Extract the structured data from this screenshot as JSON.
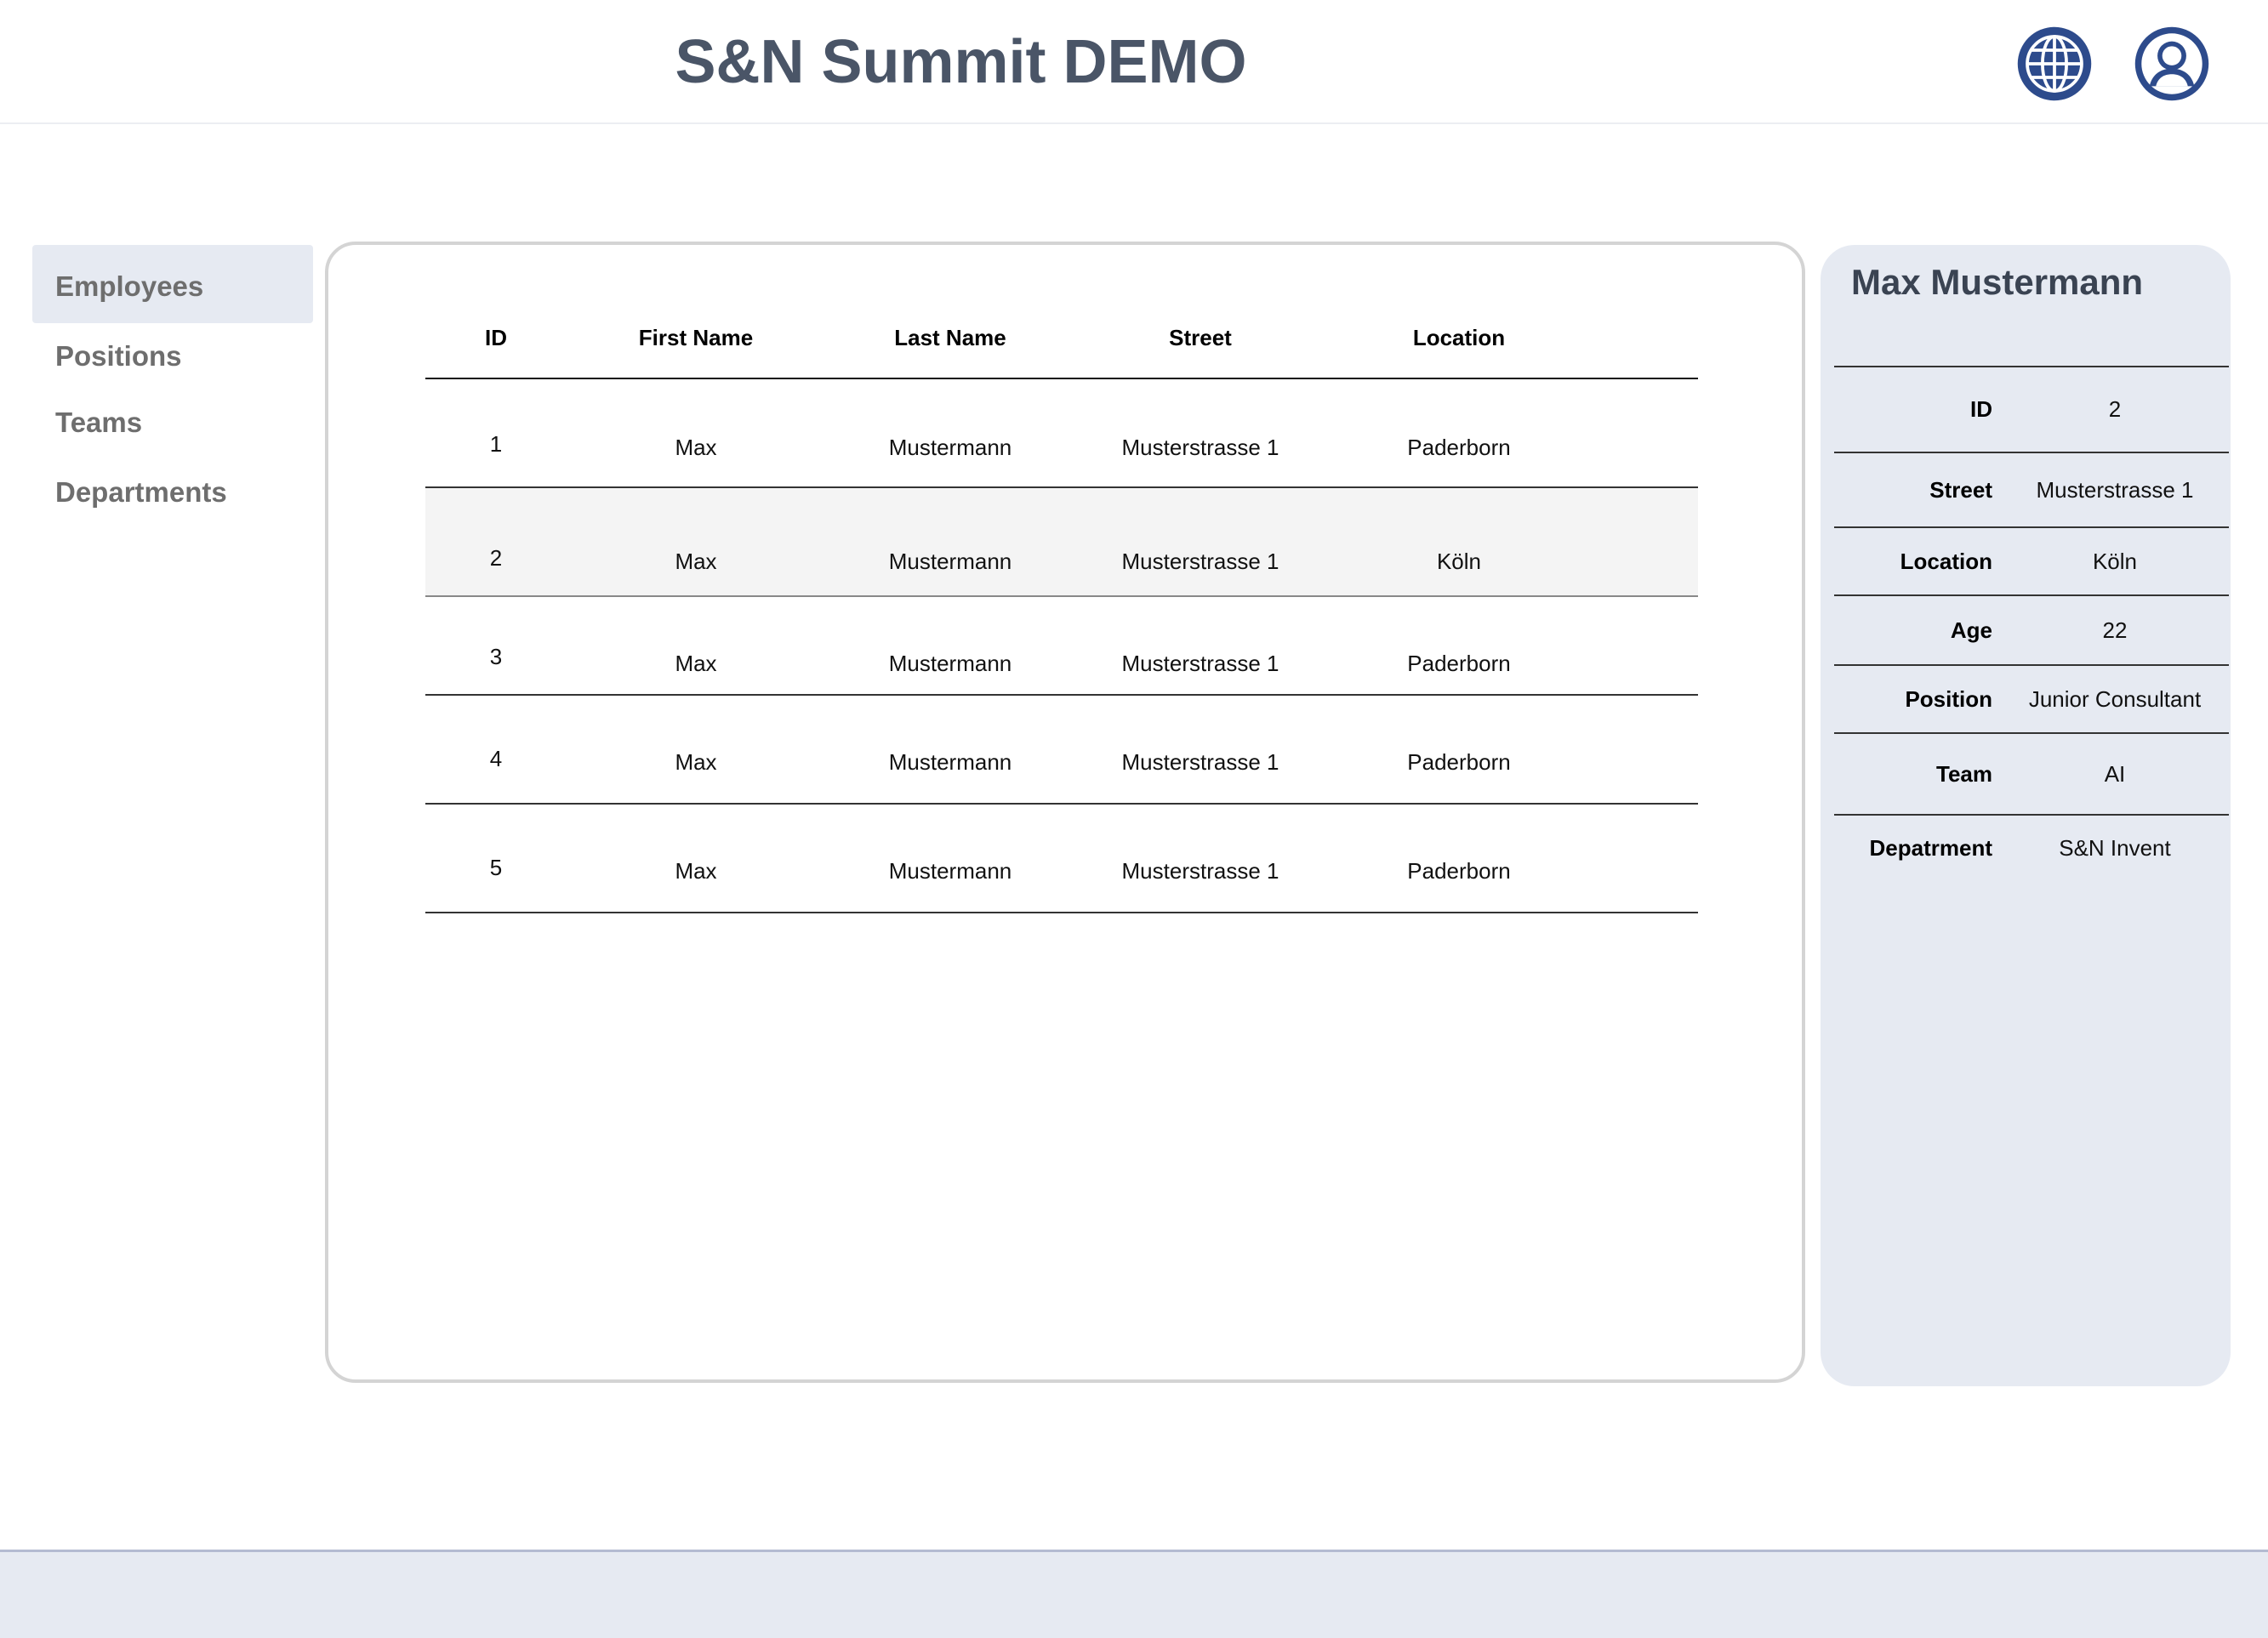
{
  "header": {
    "title": "S&N Summit DEMO",
    "icons": [
      "globe-icon",
      "user-icon"
    ],
    "icon_color": "#2d4b8c"
  },
  "sidebar": {
    "items": [
      {
        "label": "Employees",
        "active": true
      },
      {
        "label": "Positions",
        "active": false
      },
      {
        "label": "Teams",
        "active": false
      },
      {
        "label": "Departments",
        "active": false
      }
    ]
  },
  "table": {
    "columns": [
      "ID",
      "First Name",
      "Last Name",
      "Street",
      "Location"
    ],
    "rows": [
      [
        "1",
        "Max",
        "Mustermann",
        "Musterstrasse 1",
        "Paderborn"
      ],
      [
        "2",
        "Max",
        "Mustermann",
        "Musterstrasse 1",
        "Köln"
      ],
      [
        "3",
        "Max",
        "Mustermann",
        "Musterstrasse 1",
        "Paderborn"
      ],
      [
        "4",
        "Max",
        "Mustermann",
        "Musterstrasse 1",
        "Paderborn"
      ],
      [
        "5",
        "Max",
        "Mustermann",
        "Musterstrasse 1",
        "Paderborn"
      ]
    ],
    "selected_row": 2
  },
  "detail": {
    "name": "Max Mustermann",
    "fields": [
      {
        "label": "ID",
        "value": "2"
      },
      {
        "label": "Street",
        "value": "Musterstrasse 1"
      },
      {
        "label": "Location",
        "value": "Köln"
      },
      {
        "label": "Age",
        "value": "22"
      },
      {
        "label": "Position",
        "value": "Junior Consultant"
      },
      {
        "label": "Team",
        "value": "AI"
      },
      {
        "label": "Depatrment",
        "value": "S&N Invent"
      }
    ]
  },
  "colors": {
    "accent_bg": "#e6eaf2",
    "title_text": "#4a5567",
    "nav_text": "#6e6e6e"
  }
}
